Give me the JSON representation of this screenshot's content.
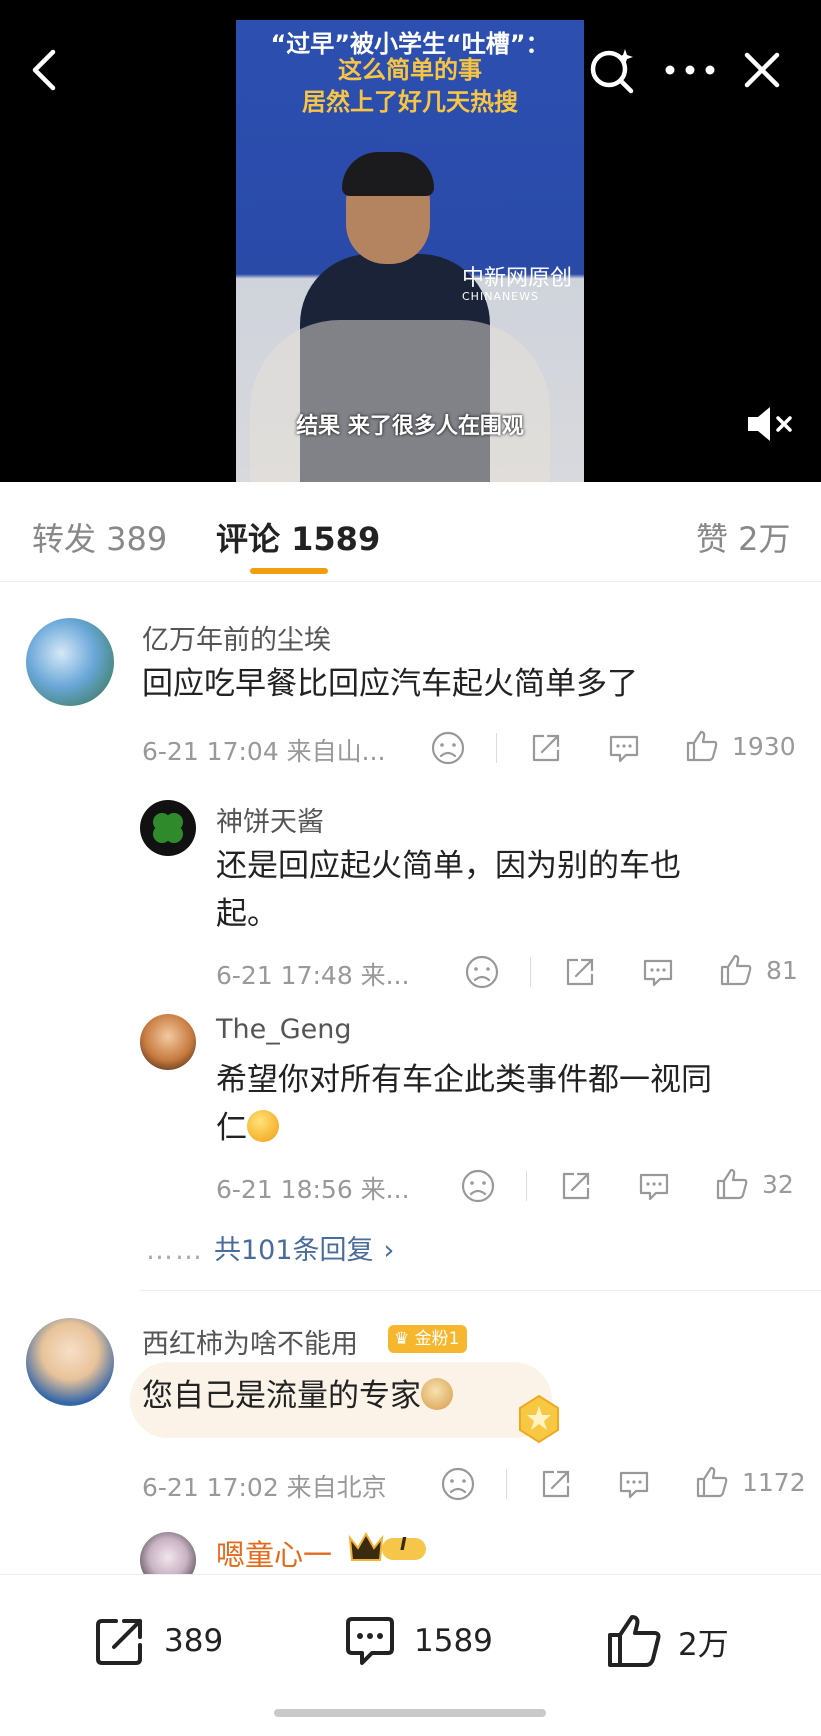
{
  "video": {
    "caption_top": "“过早”被小学生“吐槽”：",
    "caption_mid_1": "这么简单的事",
    "caption_mid_2": "居然上了好几天热搜",
    "caption_bottom": "结果 来了很多人在围观",
    "watermark": "中新网原创",
    "watermark_sub": "CHINANEWS"
  },
  "header": {
    "back_icon": "chevron-left-icon",
    "search_icon": "search-sparkle-icon",
    "more_icon": "more-dots-icon",
    "close_icon": "close-icon",
    "mute_icon": "muted-speaker-icon"
  },
  "tabs": {
    "repost": "转发 389",
    "comments": "评论 1589",
    "likes": "赞 2万",
    "accent": "#f29d0c"
  },
  "comments": [
    {
      "user": "亿万年前的尘埃",
      "text": "回应吃早餐比回应汽车起火简单多了",
      "meta": "6-21 17:04  来自山...",
      "likes": "1930",
      "replies": [
        {
          "user": "神饼天酱",
          "text_line1": "还是回应起火简单，因为别的车也",
          "text_line2": "起。",
          "meta": "6-21 17:48  来...",
          "likes": "81"
        },
        {
          "user": "The_Geng",
          "text_line1": "希望你对所有车企此类事件都一视同",
          "text_line2": "仁",
          "meta": "6-21 18:56  来...",
          "likes": "32"
        }
      ],
      "more_replies": "共101条回复"
    },
    {
      "user": "西红柿为啥不能用",
      "badge": "金粉1",
      "text": "您自己是流量的专家",
      "meta": "6-21 17:02  来自北京",
      "likes": "1172"
    },
    {
      "user": "嗯童心一",
      "vip_level": "I"
    }
  ],
  "bottom_bar": {
    "repost_count": "389",
    "comment_count": "1589",
    "like_count": "2万"
  },
  "colors": {
    "link_blue": "#4a6c9c",
    "vip_orange": "#e36a1a",
    "gold_badge": "#f6b72e"
  }
}
